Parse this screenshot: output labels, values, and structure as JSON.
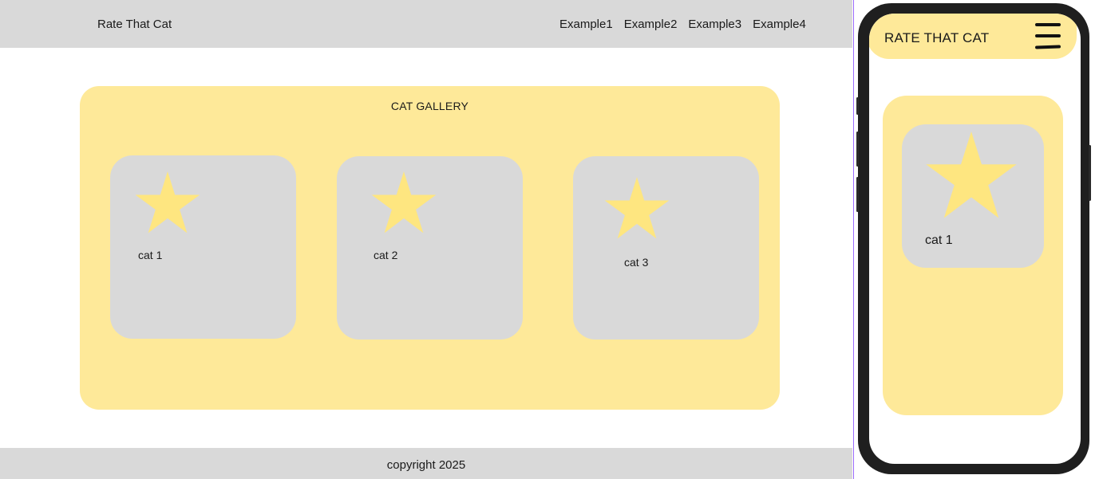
{
  "desktop": {
    "brand": "Rate That Cat",
    "nav": [
      "Example1",
      "Example2",
      "Example3",
      "Example4"
    ],
    "gallery_title": "CAT GALLERY",
    "cards": [
      {
        "label": "cat 1",
        "icon": "star-icon"
      },
      {
        "label": "cat 2",
        "icon": "star-icon"
      },
      {
        "label": "cat 3",
        "icon": "star-icon"
      }
    ],
    "footer": "copyright 2025"
  },
  "mobile": {
    "brand": "RATE THAT CAT",
    "menu_icon": "hamburger-menu-icon",
    "card": {
      "label": "cat 1",
      "icon": "star-icon"
    }
  },
  "colors": {
    "header_gray": "#d9d9d9",
    "gallery_yellow": "#fee999",
    "card_gray": "#d9d9d9",
    "star_yellow": "#fee680",
    "phone_body": "#1f1f1f"
  }
}
